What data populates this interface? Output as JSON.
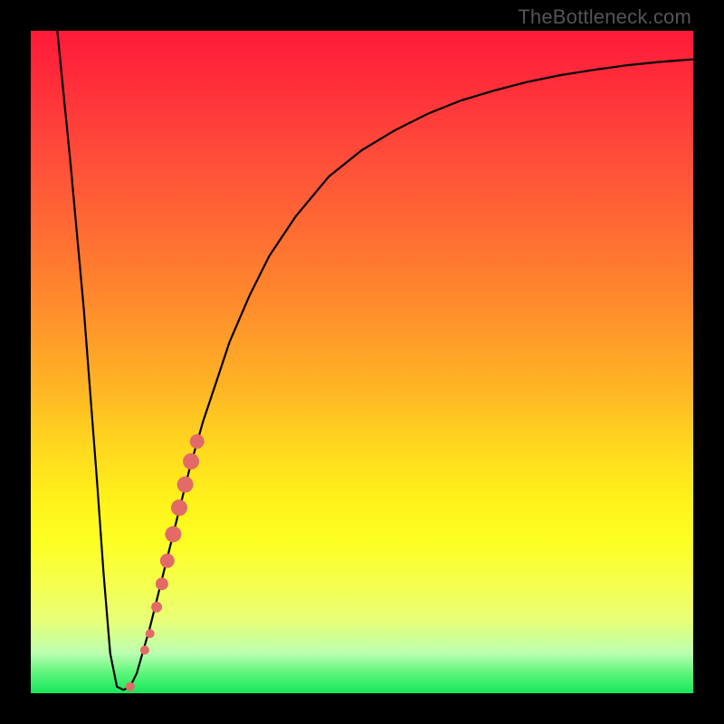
{
  "attribution": "TheBottleneck.com",
  "chart_data": {
    "type": "line",
    "title": "",
    "xlabel": "",
    "ylabel": "",
    "xlim": [
      0,
      100
    ],
    "ylim": [
      0,
      100
    ],
    "series": [
      {
        "name": "bottleneck-curve",
        "x": [
          4,
          6,
          8,
          10,
          11,
          12,
          13,
          14,
          15,
          16,
          18,
          20,
          22,
          24,
          26,
          28,
          30,
          33,
          36,
          40,
          45,
          50,
          55,
          60,
          65,
          70,
          75,
          80,
          85,
          90,
          95,
          100
        ],
        "y": [
          100,
          80,
          58,
          32,
          18,
          6,
          1,
          0.5,
          1,
          3,
          10,
          18,
          26,
          34,
          41,
          47,
          53,
          60,
          66,
          72,
          78,
          82,
          85,
          87.5,
          89.5,
          91,
          92.3,
          93.3,
          94.1,
          94.8,
          95.3,
          95.7
        ]
      }
    ],
    "markers": {
      "name": "highlight-dots",
      "color": "#e36a66",
      "points": [
        {
          "x": 15.0,
          "y": 1.0,
          "r": 5
        },
        {
          "x": 17.2,
          "y": 6.5,
          "r": 5
        },
        {
          "x": 18.0,
          "y": 9.0,
          "r": 5
        },
        {
          "x": 19.0,
          "y": 13.0,
          "r": 6
        },
        {
          "x": 19.8,
          "y": 16.5,
          "r": 7
        },
        {
          "x": 20.6,
          "y": 20.0,
          "r": 8
        },
        {
          "x": 21.5,
          "y": 24.0,
          "r": 9
        },
        {
          "x": 22.4,
          "y": 28.0,
          "r": 9
        },
        {
          "x": 23.3,
          "y": 31.5,
          "r": 9
        },
        {
          "x": 24.2,
          "y": 35.0,
          "r": 9
        },
        {
          "x": 25.1,
          "y": 38.0,
          "r": 8
        }
      ]
    },
    "grid": false
  }
}
